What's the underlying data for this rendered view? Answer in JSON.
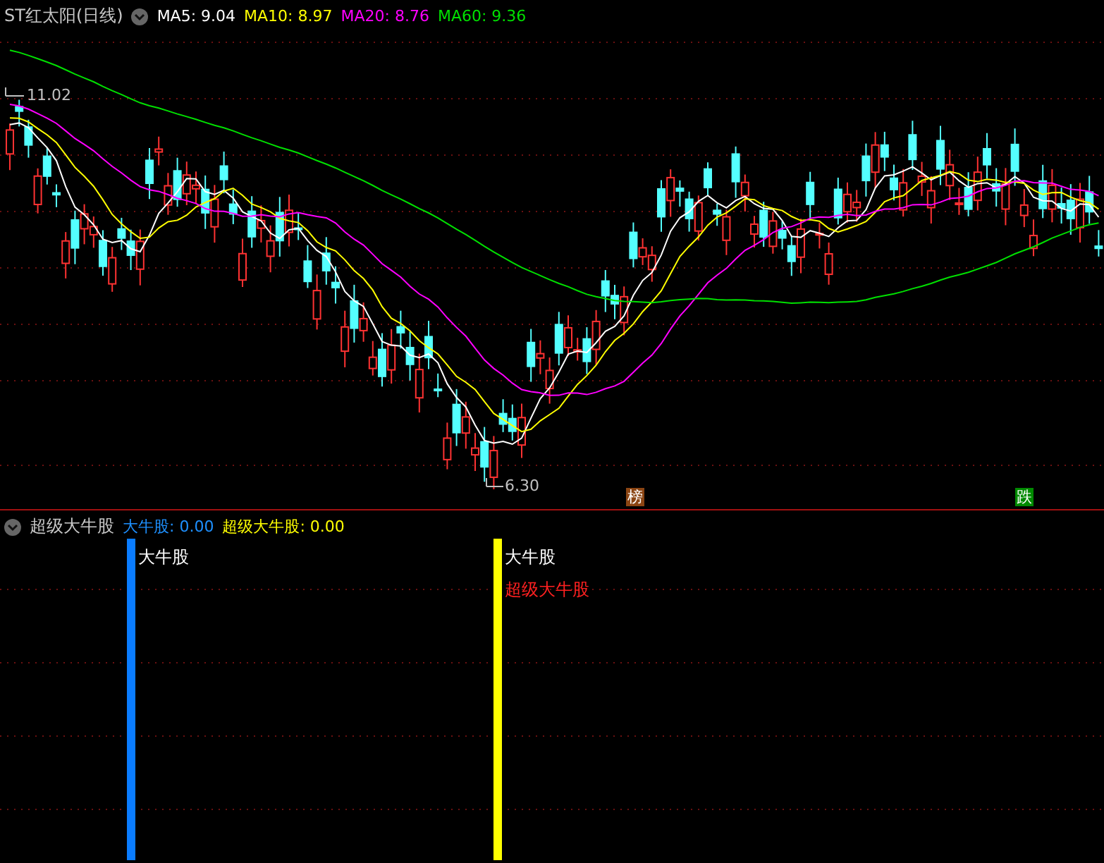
{
  "main_chart": {
    "title": "ST红太阳(日线)",
    "indicators": [
      {
        "label": "MA5: 9.04",
        "color": "#ffffff"
      },
      {
        "label": "MA10: 8.97",
        "color": "#ffff00"
      },
      {
        "label": "MA20: 8.76",
        "color": "#ff00ff"
      },
      {
        "label": "MA60: 9.36",
        "color": "#00e000"
      }
    ],
    "high_label": "11.02",
    "low_label": "6.30",
    "badges": [
      {
        "text": "榜",
        "color": "#8b4513"
      },
      {
        "text": "跌",
        "color": "#008a00"
      }
    ]
  },
  "sub_chart": {
    "title": "超级大牛股",
    "indicators": [
      {
        "label": "大牛股: 0.00",
        "color": "#1e90ff"
      },
      {
        "label": "超级大牛股: 0.00",
        "color": "#ffff00"
      }
    ],
    "signals": [
      {
        "color": "#0a7cff",
        "labels": [
          {
            "text": "大牛股",
            "color": "#ffffff"
          }
        ]
      },
      {
        "color": "#ffff00",
        "labels": [
          {
            "text": "大牛股",
            "color": "#ffffff"
          },
          {
            "text": "超级大牛股",
            "color": "#ff2020"
          }
        ]
      }
    ]
  }
}
